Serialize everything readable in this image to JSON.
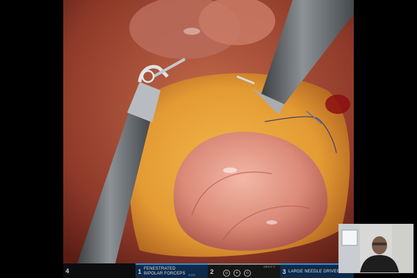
{
  "video": {
    "description_source": "endoscopic surgical camera feed"
  },
  "status_bar": {
    "arms": [
      {
        "number": "4",
        "label": ""
      },
      {
        "number": "1",
        "label_line1": "FENESTRATED",
        "label_line2": "BIPOLAR FORCEPS",
        "badge": "SIGN"
      },
      {
        "number": "2",
        "label": "",
        "camera_angle": "Angle 0°"
      },
      {
        "number": "3",
        "label": "LARGE NEEDLE DRIVER"
      }
    ],
    "accent_color": "#2f8fd8",
    "active_bg": "#0e2a4a"
  },
  "pip": {
    "subject": "surgeon-webcam"
  }
}
